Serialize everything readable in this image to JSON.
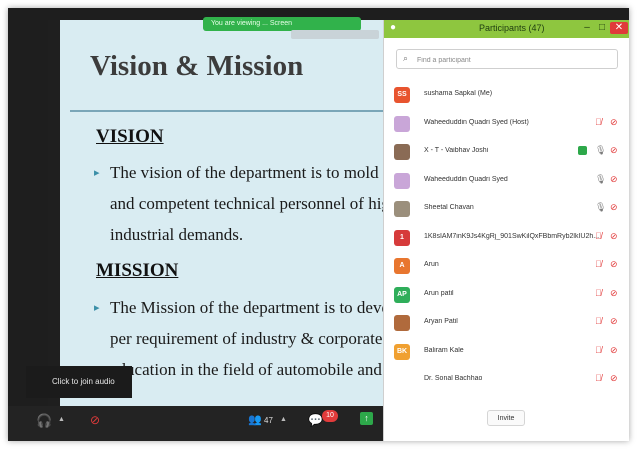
{
  "slide": {
    "title": "Vision & Mission",
    "vision_heading": "VISION",
    "vision_lines": [
      "The vision of the department is to mold t",
      "and competent technical personnel of hig",
      "industrial demands."
    ],
    "mission_heading": "MISSION",
    "mission_lines": [
      "The Mission of the department is to develo",
      "per requirement of industry & corporate",
      "education in the field of automobile and ma"
    ]
  },
  "share_banner": "You are viewing ... Screen",
  "audio_tooltip": "Click to join audio",
  "toolbar": {
    "participants_count": "47",
    "chat_badge": "10"
  },
  "participants_panel": {
    "title": "Participants (47)",
    "search_placeholder": "Find a participant",
    "invite_label": "Invite",
    "participants": [
      {
        "name": "sushama Sapkal (Me)",
        "initials": "SS",
        "avatar_color": "#e8542f",
        "mic": "none",
        "cam": "none"
      },
      {
        "name": "Waheeduddin Quadri Syed (Host)",
        "initials": "",
        "avatar_color": "#c9a6d8",
        "mic": "muted",
        "cam": "off"
      },
      {
        "name": "X - T - Vaibhav Joshi",
        "initials": "",
        "avatar_color": "#8a6b55",
        "mic": "on",
        "cam": "off",
        "sharing": true
      },
      {
        "name": "Waheeduddin Quadri Syed",
        "initials": "",
        "avatar_color": "#c9a6d8",
        "mic": "on",
        "cam": "off"
      },
      {
        "name": "Sheetal Chavan",
        "initials": "",
        "avatar_color": "#9b8f7c",
        "mic": "on",
        "cam": "off"
      },
      {
        "name": "1K8sIAM7inK9Js4KgRj_901SwKilQxFBbmRyb2lkIU2h...",
        "initials": "1",
        "avatar_color": "#d63b3b",
        "mic": "muted",
        "cam": "off"
      },
      {
        "name": "Arun",
        "initials": "A",
        "avatar_color": "#e8762f",
        "mic": "muted",
        "cam": "off"
      },
      {
        "name": "Arun patil",
        "initials": "AP",
        "avatar_color": "#2fae5a",
        "mic": "muted",
        "cam": "off"
      },
      {
        "name": "Aryan Patil",
        "initials": "",
        "avatar_color": "#b06a3c",
        "mic": "muted",
        "cam": "off"
      },
      {
        "name": "Baliram Kale",
        "initials": "BK",
        "avatar_color": "#f0a030",
        "mic": "muted",
        "cam": "off"
      },
      {
        "name": "Dr. Sonal Bachhao",
        "initials": "",
        "avatar_color": "#ffffff",
        "mic": "muted",
        "cam": "off"
      }
    ]
  }
}
